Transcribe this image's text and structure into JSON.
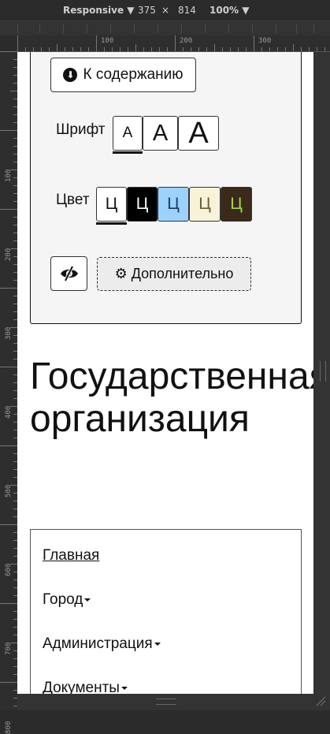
{
  "devtools": {
    "device": "Responsive",
    "width": "375",
    "times": "×",
    "height": "814",
    "zoom": "100%"
  },
  "ruler": {
    "top_labels": [
      "100",
      "200",
      "300"
    ],
    "left_labels": [
      "100",
      "200",
      "300",
      "400",
      "500",
      "600",
      "700",
      "800"
    ]
  },
  "panel": {
    "toc_label": "К содержанию",
    "font_label": "Шрифт",
    "font_sizes": [
      "А",
      "А",
      "А"
    ],
    "color_label": "Цвет",
    "color_options": [
      {
        "glyph": "Ц",
        "bg": "#ffffff",
        "fg": "#111111"
      },
      {
        "glyph": "Ц",
        "bg": "#000000",
        "fg": "#ffffff"
      },
      {
        "glyph": "Ц",
        "bg": "#9dd1ff",
        "fg": "#1e3a5a"
      },
      {
        "glyph": "Ц",
        "bg": "#f7f2d8",
        "fg": "#6b5a2e"
      },
      {
        "glyph": "Ц",
        "bg": "#3b2a19",
        "fg": "#a6d84d"
      }
    ],
    "more_label": "Дополнительно"
  },
  "page": {
    "title": "Государственная организация"
  },
  "nav": {
    "items": [
      "Главная",
      "Город",
      "Администрация",
      "Документы"
    ]
  },
  "icons": {
    "toc": "arrow-down-circle-icon",
    "eye": "eye-slash-icon",
    "gear": "gear-icon"
  }
}
